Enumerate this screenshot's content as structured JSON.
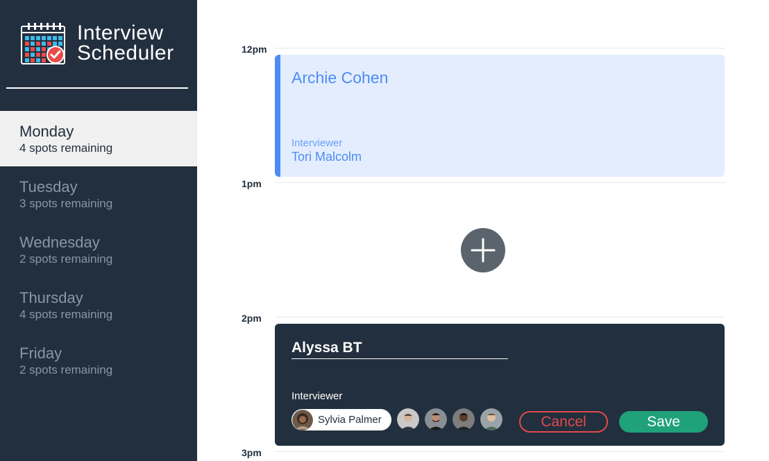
{
  "app": {
    "title_line1": "Interview",
    "title_line2": "Scheduler",
    "logo_icon": "calendar-check-icon"
  },
  "sidebar": {
    "days": [
      {
        "name": "Monday",
        "spots": "4 spots remaining",
        "selected": true
      },
      {
        "name": "Tuesday",
        "spots": "3 spots remaining",
        "selected": false
      },
      {
        "name": "Wednesday",
        "spots": "2 spots remaining",
        "selected": false
      },
      {
        "name": "Thursday",
        "spots": "4 spots remaining",
        "selected": false
      },
      {
        "name": "Friday",
        "spots": "2 spots remaining",
        "selected": false
      }
    ]
  },
  "schedule": {
    "times": [
      "12pm",
      "1pm",
      "2pm",
      "3pm"
    ],
    "appointment": {
      "student": "Archie Cohen",
      "interviewer_label": "Interviewer",
      "interviewer": "Tori Malcolm"
    },
    "add_icon": "plus-icon",
    "form": {
      "student_value": "Alyssa BT",
      "interviewer_label": "Interviewer",
      "selected_interviewer": "Sylvia Palmer",
      "other_interviewer_count": 4,
      "cancel_label": "Cancel",
      "save_label": "Save"
    }
  },
  "colors": {
    "sidebar_bg": "#222f3e",
    "appointment_bg": "#e4edfd",
    "appointment_accent": "#4b8cf5",
    "add_button": "#5b636c",
    "cancel": "#e24a4a",
    "save": "#1fa17a"
  }
}
